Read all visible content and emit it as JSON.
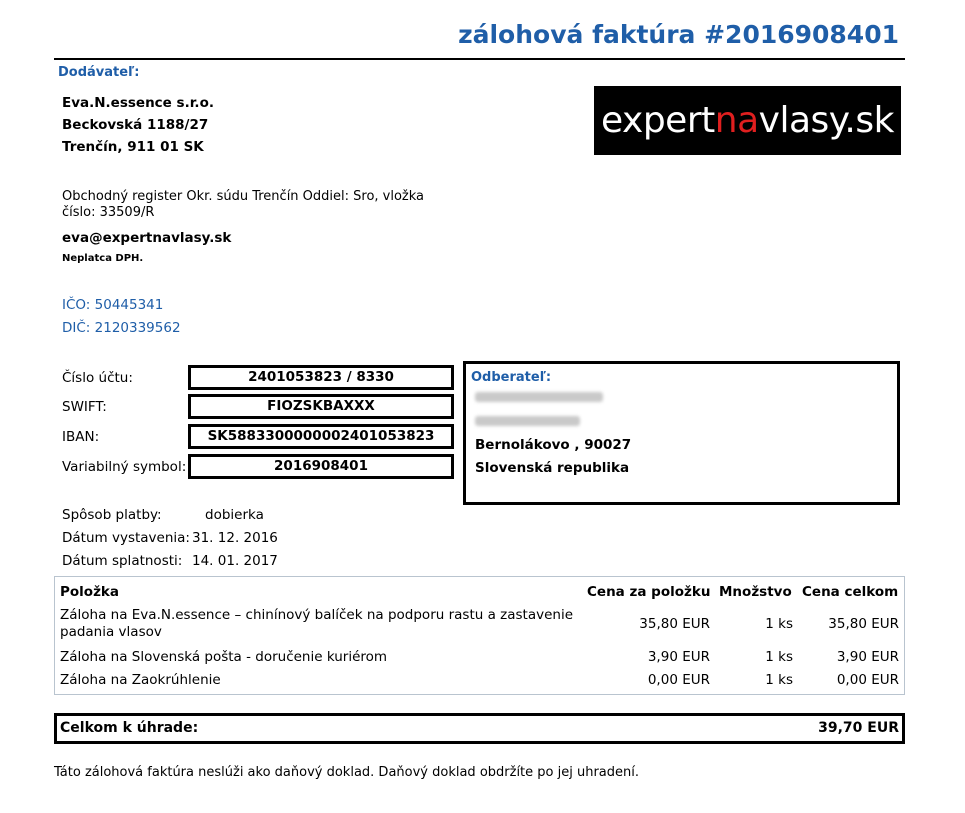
{
  "title": "zálohová faktúra #2016908401",
  "supplier": {
    "heading": "Dodávateľ:",
    "name": "Eva.N.essence s.r.o.",
    "street": "Beckovská 1188/27",
    "city": "Trenčín, 911 01 SK",
    "register_line1": "Obchodný register Okr. súdu Trenčín Oddiel: Sro, vložka",
    "register_line2": "číslo: 33509/R",
    "email": "eva@expertnavlasy.sk",
    "vat_note": "Neplatca DPH.",
    "ico": "IČO: 50445341",
    "dic": "DIČ: 2120339562"
  },
  "logo": {
    "pre": "expert",
    "accent": "na",
    "post": "vlasy.sk",
    "accent_color": "#e01f1f"
  },
  "payment": {
    "account_label": "Číslo účtu:",
    "account_value": "2401053823 / 8330",
    "swift_label": "SWIFT:",
    "swift_value": "FIOZSKBAXXX",
    "iban_label": "IBAN:",
    "iban_value": "SK5883300000002401053823",
    "vs_label": "Variabilný symbol:",
    "vs_value": "2016908401",
    "method_label": "Spôsob platby:",
    "method_value": "dobierka",
    "issued_label": "Dátum vystavenia:",
    "issued_value": "31. 12. 2016",
    "due_label": "Dátum splatnosti:",
    "due_value": "14. 01. 2017"
  },
  "buyer": {
    "heading": "Odberateľ:",
    "city": "Bernolákovo , 90027",
    "country": "Slovenská republika"
  },
  "items": {
    "headers": [
      "Položka",
      "Cena za položku",
      "Množstvo",
      "Cena celkom"
    ],
    "rows": [
      {
        "name1": "Záloha na Eva.N.essence – chinínový balíček na podporu rastu a zastavenie",
        "name2": "padania vlasov",
        "price": "35,80 EUR",
        "qty": "1 ks",
        "total": "35,80 EUR"
      },
      {
        "name1": "Záloha na Slovenská pošta - doručenie kuriérom",
        "name2": "",
        "price": "3,90 EUR",
        "qty": "1 ks",
        "total": "3,90 EUR"
      },
      {
        "name1": "Záloha na Zaokrúhlenie",
        "name2": "",
        "price": "0,00 EUR",
        "qty": "1 ks",
        "total": "0,00 EUR"
      }
    ]
  },
  "total": {
    "label": "Celkom k úhrade:",
    "value": "39,70 EUR"
  },
  "footer_note": "Táto zálohová faktúra neslúži ako daňový doklad. Daňový doklad obdržíte po jej uhradení."
}
